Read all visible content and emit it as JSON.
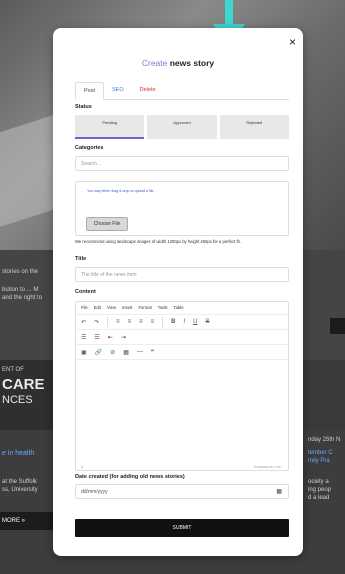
{
  "background": {
    "side_texts": [
      "stories on the",
      "bution to ... M",
      "and the right to",
      "ENT OF",
      "CARE",
      "NCES",
      "e in health",
      "at the Suffolk",
      "ss, University",
      "MORE »",
      "nday 25th N",
      "tember C",
      "mily Pra",
      "ociety a",
      "ing peop",
      "d a lead"
    ]
  },
  "modal": {
    "close_icon": "×",
    "title_prefix": "Create",
    "title_bold": "news story",
    "tabs": [
      "Post",
      "SEO",
      "Delete"
    ],
    "status_label": "Status",
    "status_options": [
      "Pending",
      "Approved",
      "Rejected"
    ],
    "categories_label": "Categories",
    "search_placeholder": "Search...",
    "upload_hint": "You may either drag & drop or upload a file.",
    "choose_file": "Choose File",
    "recommend_text": "We recommend using landscape images of width 1250px by height 460px for a perfect fit.",
    "title_label": "Title",
    "title_placeholder": "The title of the news item",
    "content_label": "Content",
    "menu": [
      "File",
      "Edit",
      "View",
      "Insert",
      "Format",
      "Tools",
      "Table"
    ],
    "toolbar_row1": [
      "↶",
      "↷",
      "≡",
      "≡",
      "≡",
      "≡",
      "B",
      "I",
      "U",
      "S"
    ],
    "toolbar_row2": [
      "☰",
      "☰",
      "⇤",
      "⇥"
    ],
    "toolbar_row3": [
      "▣",
      "🔗",
      "⊘",
      "▦",
      "—",
      "❞"
    ],
    "path_char": "p",
    "powered_by": "POWERED BY TINY",
    "date_label": "Date created (for adding old news stories)",
    "date_placeholder": "dd/mm/yyyy",
    "submit_label": "SUBMIT"
  },
  "colors": {
    "accent": "#7a5cd6",
    "link": "#3b7ddd",
    "danger": "#e02a2a",
    "teal": "#3dd6d0"
  }
}
